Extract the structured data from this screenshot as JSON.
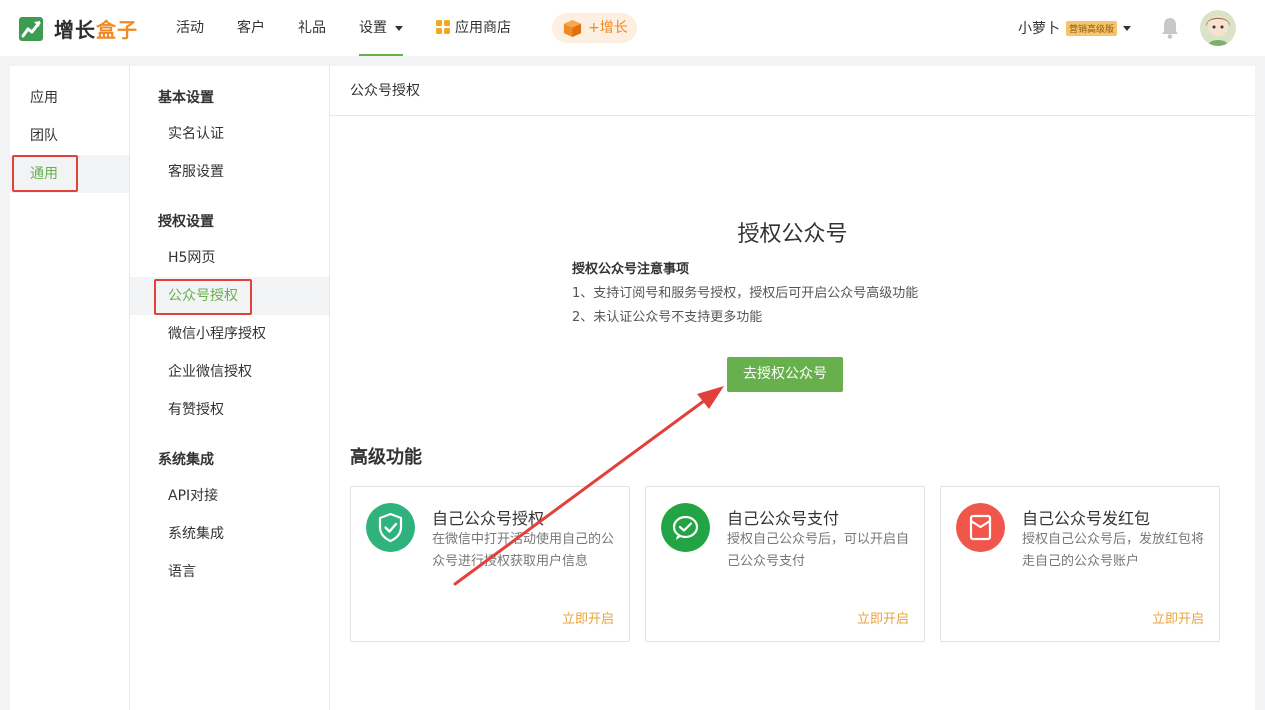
{
  "brand": {
    "name_part1": "增长",
    "name_part2": "盒子"
  },
  "nav": {
    "items": [
      "活动",
      "客户",
      "礼品",
      "设置",
      "应用商店"
    ],
    "grow_label": "+增长"
  },
  "user": {
    "name": "小萝卜",
    "badge": "营销高级版"
  },
  "col1": {
    "items": [
      "应用",
      "团队",
      "通用"
    ]
  },
  "col2": {
    "groups": [
      {
        "title": "基本设置",
        "items": [
          "实名认证",
          "客服设置"
        ]
      },
      {
        "title": "授权设置",
        "items": [
          "H5网页",
          "公众号授权",
          "微信小程序授权",
          "企业微信授权",
          "有赞授权"
        ]
      },
      {
        "title": "系统集成",
        "items": [
          "API对接",
          "系统集成",
          "语言"
        ]
      }
    ]
  },
  "main": {
    "header": "公众号授权",
    "title": "授权公众号",
    "notes_head": "授权公众号注意事项",
    "notes": [
      "1、支持订阅号和服务号授权，授权后可开启公众号高级功能",
      "2、未认证公众号不支持更多功能"
    ],
    "button": "去授权公众号",
    "advanced_title": "高级功能",
    "cards": [
      {
        "title": "自己公众号授权",
        "desc": "在微信中打开活动使用自己的公众号进行授权获取用户信息",
        "link": "立即开启",
        "icon": "shield-check-icon",
        "color": "#2fb27b"
      },
      {
        "title": "自己公众号支付",
        "desc": "授权自己公众号后，可以开启自己公众号支付",
        "link": "立即开启",
        "icon": "wechat-pay-icon",
        "color": "#22a344"
      },
      {
        "title": "自己公众号发红包",
        "desc": "授权自己公众号后，发放红包将走自己的公众号账户",
        "link": "立即开启",
        "icon": "red-packet-icon",
        "color": "#f0574a"
      }
    ]
  },
  "colors": {
    "accent": "#67b04d",
    "orange": "#f08a24",
    "highlight": "#e2403a"
  }
}
